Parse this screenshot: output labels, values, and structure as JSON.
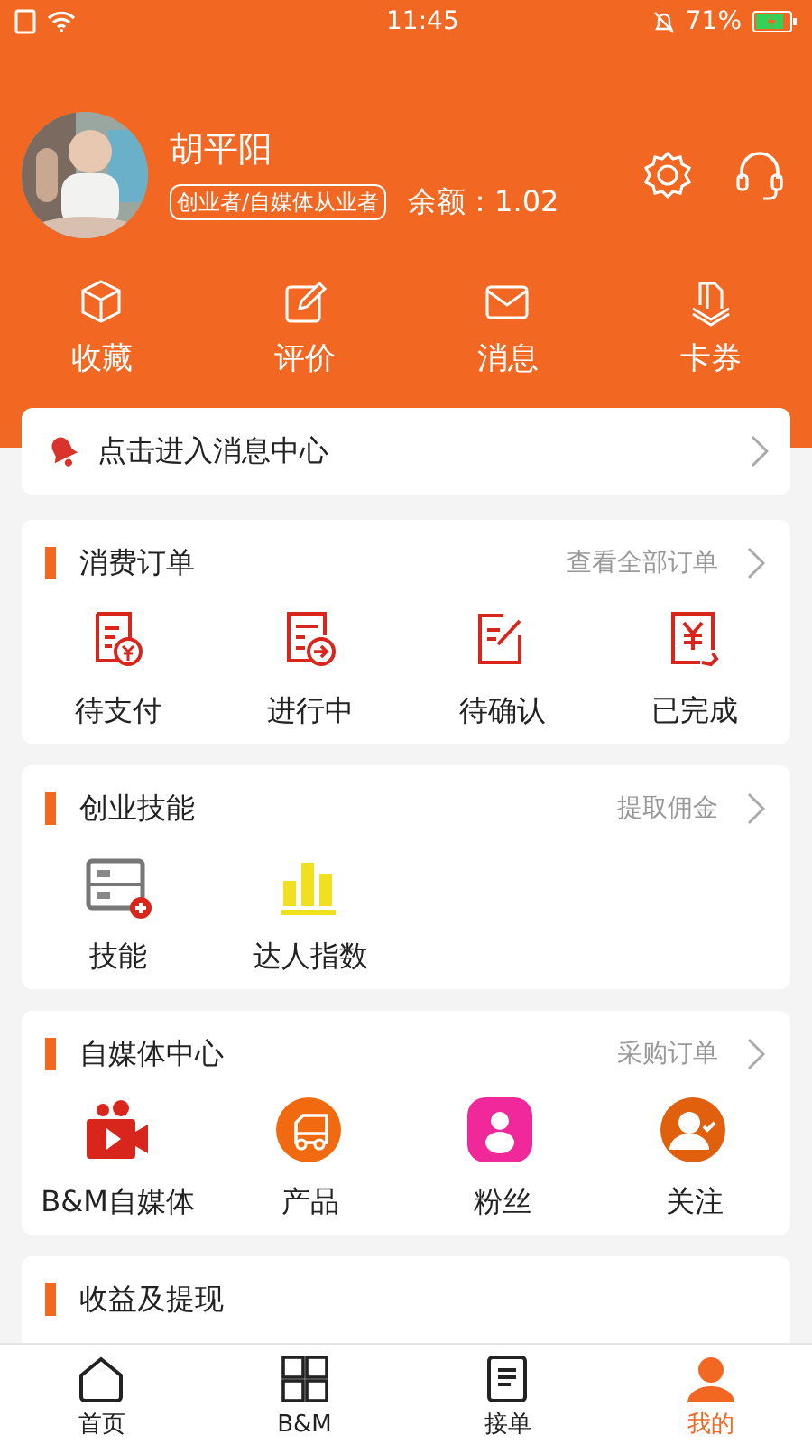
{
  "status_bar": {
    "time": "11:45",
    "battery": "71%"
  },
  "profile": {
    "name": "胡平阳",
    "tag": "创业者/自媒体从业者",
    "balance": "余额：1.02"
  },
  "quick_links": [
    {
      "label": "收藏"
    },
    {
      "label": "评价"
    },
    {
      "label": "消息"
    },
    {
      "label": "卡券"
    }
  ],
  "message_bar": {
    "text": "点击进入消息中心"
  },
  "sections": [
    {
      "title": "消费订单",
      "link": "查看全部订单",
      "items": [
        {
          "label": "待支付"
        },
        {
          "label": "进行中"
        },
        {
          "label": "待确认"
        },
        {
          "label": "已完成"
        }
      ]
    },
    {
      "title": "创业技能",
      "link": "提取佣金",
      "items": [
        {
          "label": "技能"
        },
        {
          "label": "达人指数"
        }
      ]
    },
    {
      "title": "自媒体中心",
      "link": "采购订单",
      "items": [
        {
          "label": "B&M自媒体"
        },
        {
          "label": "产品"
        },
        {
          "label": "粉丝"
        },
        {
          "label": "关注"
        }
      ]
    },
    {
      "title": "收益及提现"
    }
  ],
  "tab_bar": [
    {
      "label": "首页",
      "selected": false
    },
    {
      "label": "B&M",
      "selected": false
    },
    {
      "label": "接单",
      "selected": false
    },
    {
      "label": "我的",
      "selected": true
    }
  ]
}
